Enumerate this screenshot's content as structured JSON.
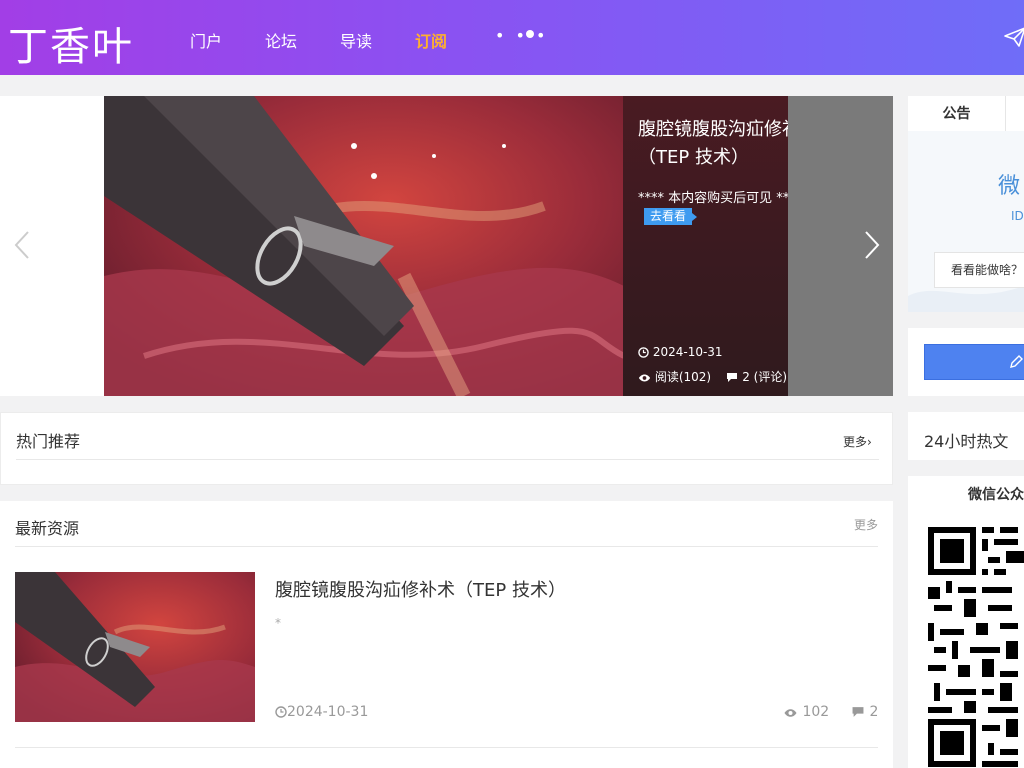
{
  "header": {
    "logo": "丁香叶",
    "nav": [
      {
        "label": "门户"
      },
      {
        "label": "论坛"
      },
      {
        "label": "导读"
      },
      {
        "label": "订阅"
      }
    ],
    "more": "• • •",
    "accent_color": "#ffb02e",
    "gradient": [
      "#a23ee6",
      "#6f6df8"
    ]
  },
  "slider": {
    "title": "腹腔镜腹股沟疝修补术（TEP 技术）",
    "desc": "**** 本内容购买后可见 ****",
    "button": "去看看",
    "date": "2024-10-31",
    "views": "阅读(102)",
    "comments": "2 (评论)"
  },
  "notice": {
    "tab": "公告",
    "wx_text": "微",
    "id_text": "ID",
    "button": "看看能做啥？"
  },
  "hot": {
    "title": "热门推荐",
    "more": "更多›"
  },
  "latest": {
    "title": "最新资源",
    "more": "更多",
    "items": [
      {
        "title": "腹腔镜腹股沟疝修补术（TEP 技术）",
        "excerpt": "*",
        "date": "2024-10-31",
        "views": "102",
        "comments": "2"
      }
    ]
  },
  "sidebar": {
    "hot24_title": "24小时热文",
    "wechat_title": "微信公众"
  },
  "icons": [
    "send-icon",
    "clock-icon",
    "eye-icon",
    "comment-icon",
    "chevron-left-icon",
    "chevron-right-icon",
    "pencil-icon",
    "qr-code-icon"
  ]
}
